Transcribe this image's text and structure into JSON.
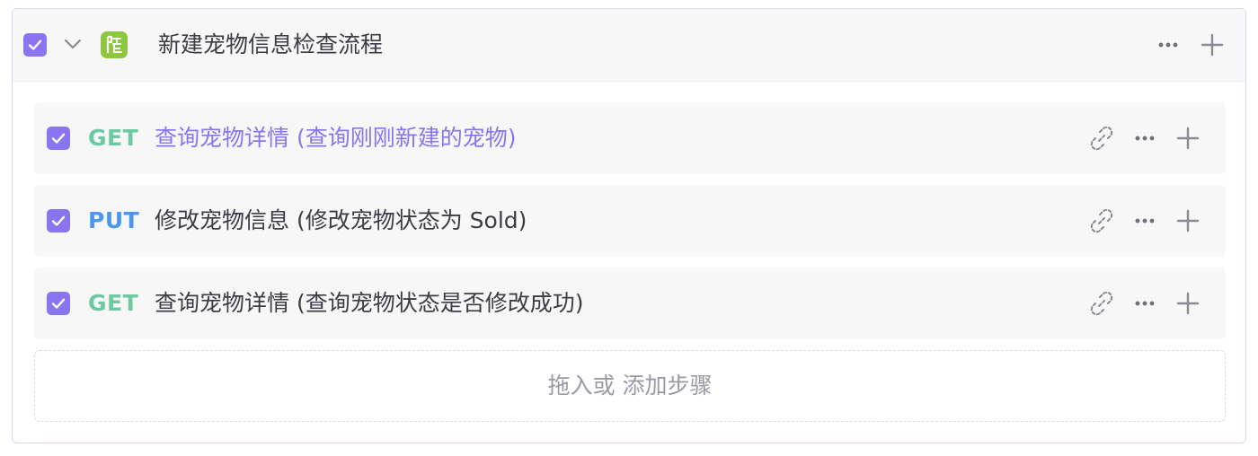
{
  "group": {
    "title": "新建宠物信息检查流程",
    "checked": true,
    "icon": "green-step-group-icon",
    "more_icon": "more-icon",
    "add_icon": "plus-icon"
  },
  "steps": [
    {
      "method": "GET",
      "name": "查询宠物详情 (查询刚刚新建的宠物)",
      "checked": true,
      "active": true
    },
    {
      "method": "PUT",
      "name": "修改宠物信息 (修改宠物状态为 Sold)",
      "checked": true,
      "active": false
    },
    {
      "method": "GET",
      "name": "查询宠物详情 (查询宠物状态是否修改成功)",
      "checked": true,
      "active": false
    }
  ],
  "step_icons": [
    "unlink-icon",
    "more-icon",
    "plus-icon"
  ],
  "dropzone": {
    "label": "拖入或 添加步骤"
  },
  "colors": {
    "accent": "#8b74f0",
    "get": "#6dc9a0",
    "put": "#4b97ec",
    "group_icon": "#8dc63f"
  }
}
